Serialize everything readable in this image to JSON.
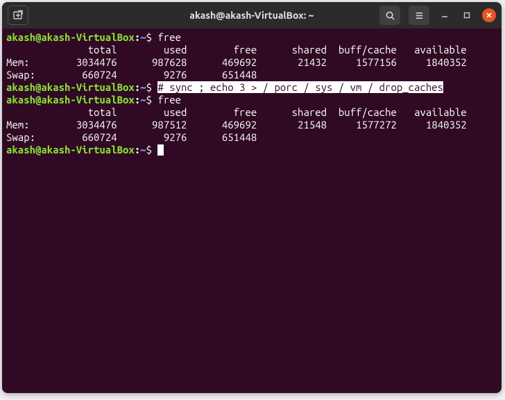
{
  "window": {
    "title": "akash@akash-VirtualBox: ~"
  },
  "prompt": {
    "user_host": "akash@akash-VirtualBox",
    "sep": ":",
    "path": "~",
    "symbol": "$"
  },
  "commands": {
    "free": "free",
    "sync_highlight": "# sync ; echo 3 > / porc / sys / vm / drop_caches"
  },
  "free1": {
    "headers": {
      "total": "total",
      "used": "used",
      "free": "free",
      "shared": "shared",
      "buffcache": "buff/cache",
      "available": "available"
    },
    "mem": {
      "label": "Mem:",
      "total": "3034476",
      "used": "987628",
      "free": "469692",
      "shared": "21432",
      "buffcache": "1577156",
      "available": "1840352"
    },
    "swap": {
      "label": "Swap:",
      "total": "660724",
      "used": "9276",
      "free": "651448"
    }
  },
  "free2": {
    "headers": {
      "total": "total",
      "used": "used",
      "free": "free",
      "shared": "shared",
      "buffcache": "buff/cache",
      "available": "available"
    },
    "mem": {
      "label": "Mem:",
      "total": "3034476",
      "used": "987512",
      "free": "469692",
      "shared": "21548",
      "buffcache": "1577272",
      "available": "1840352"
    },
    "swap": {
      "label": "Swap:",
      "total": "660724",
      "used": "9276",
      "free": "651448"
    }
  }
}
